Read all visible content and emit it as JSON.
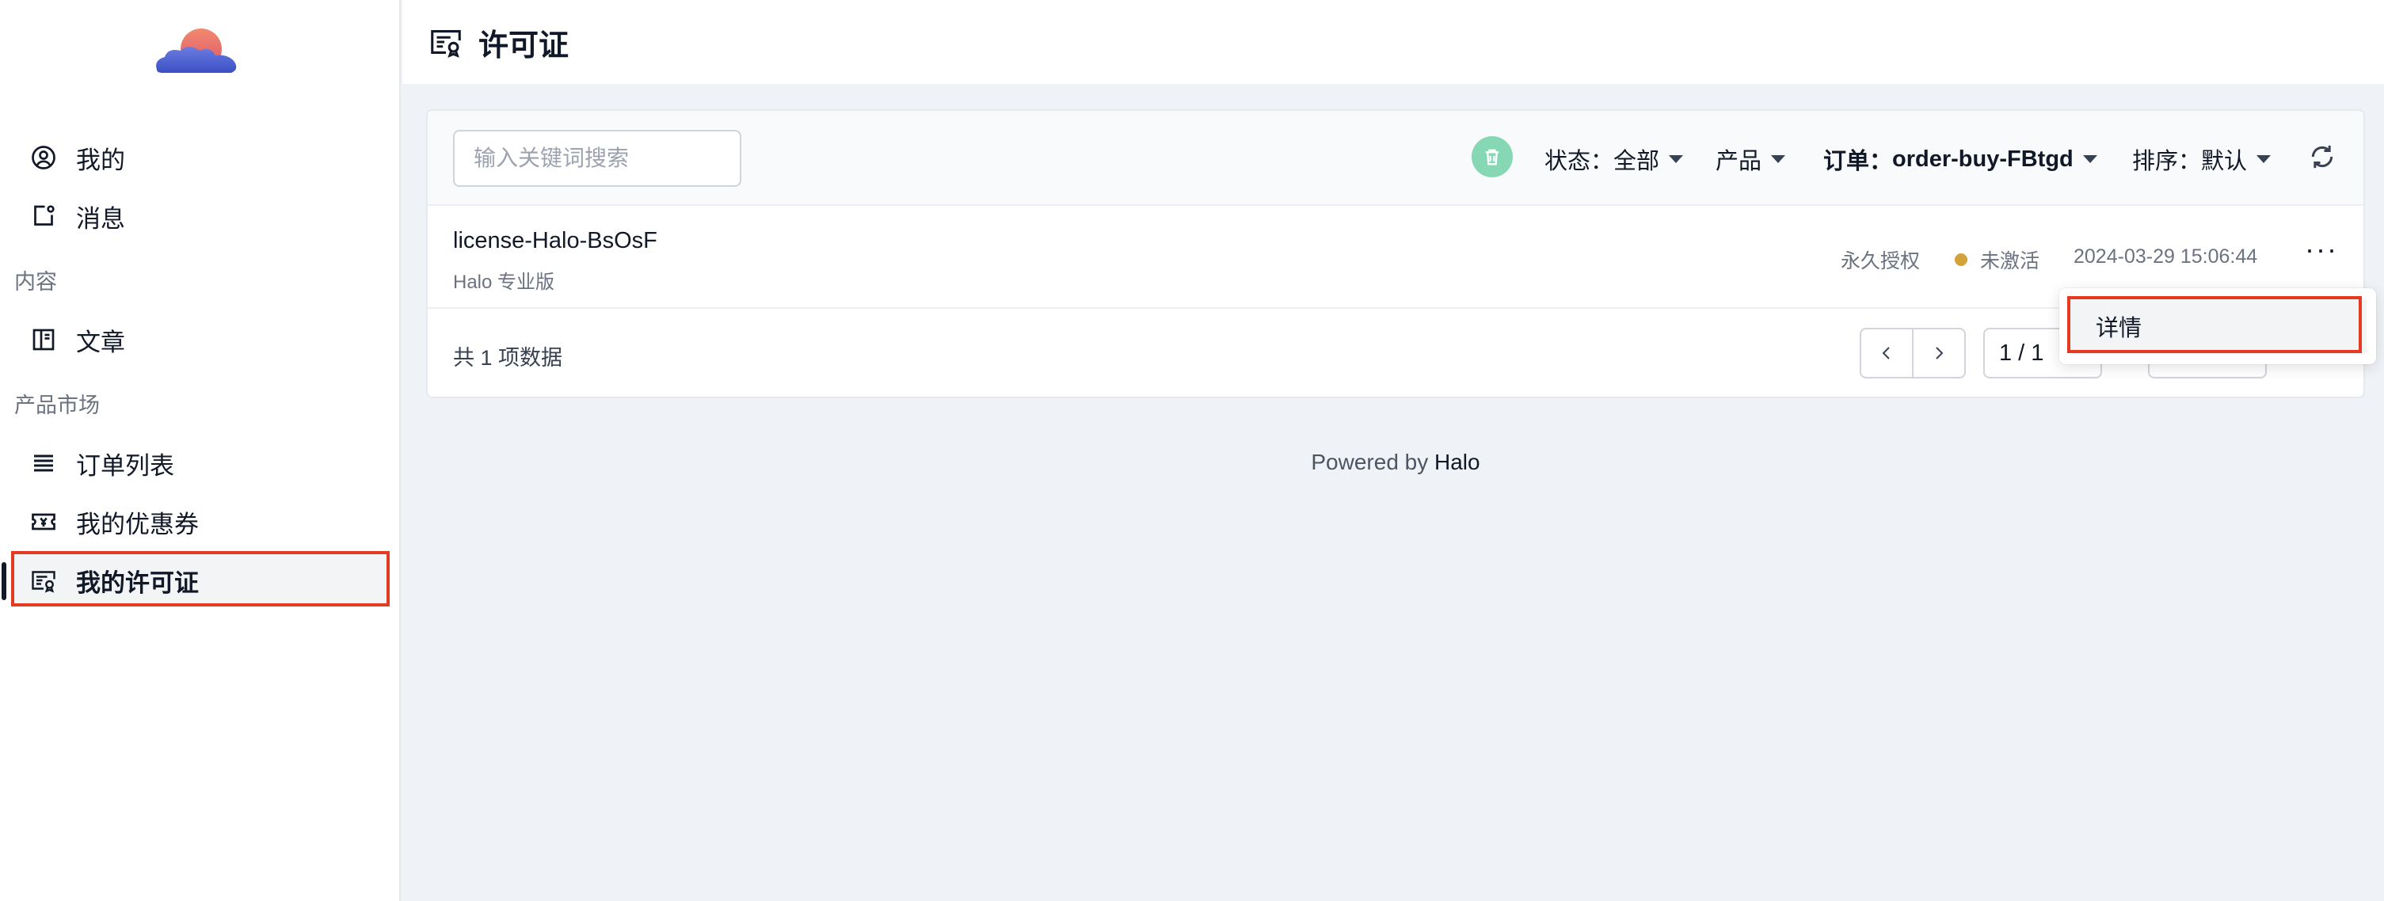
{
  "sidebar": {
    "items": [
      {
        "label": "我的",
        "icon": "user-circle-icon"
      },
      {
        "label": "消息",
        "icon": "message-icon"
      },
      {
        "label": "文章",
        "icon": "book-icon"
      },
      {
        "label": "订单列表",
        "icon": "list-icon"
      },
      {
        "label": "我的优惠券",
        "icon": "coupon-icon"
      },
      {
        "label": "我的许可证",
        "icon": "license-icon"
      }
    ],
    "sections": [
      "内容",
      "产品市场"
    ]
  },
  "header": {
    "title": "许可证"
  },
  "toolbar": {
    "search_placeholder": "输入关键词搜索",
    "status_label": "状态：",
    "status_value": "全部",
    "product_label": "产品",
    "order_label": "订单：",
    "order_value": "order-buy-FBtgd",
    "sort_label": "排序：",
    "sort_value": "默认"
  },
  "licenses": [
    {
      "name": "license-Halo-BsOsF",
      "product": "Halo 专业版",
      "permission": "永久授权",
      "status": "未激活",
      "date": "2024-03-29 15:06:44",
      "more": "···"
    }
  ],
  "pagination": {
    "total_text": "共 1 项数据",
    "page_text": "1 / 1"
  },
  "dropdown": {
    "detail_label": "详情"
  },
  "footer": {
    "powered_prefix": "Powered by ",
    "powered_brand": "Halo"
  },
  "colors": {
    "accent_highlight": "#e23b22",
    "trash_button": "#86d8b4",
    "status_dot": "#d4a23a"
  }
}
